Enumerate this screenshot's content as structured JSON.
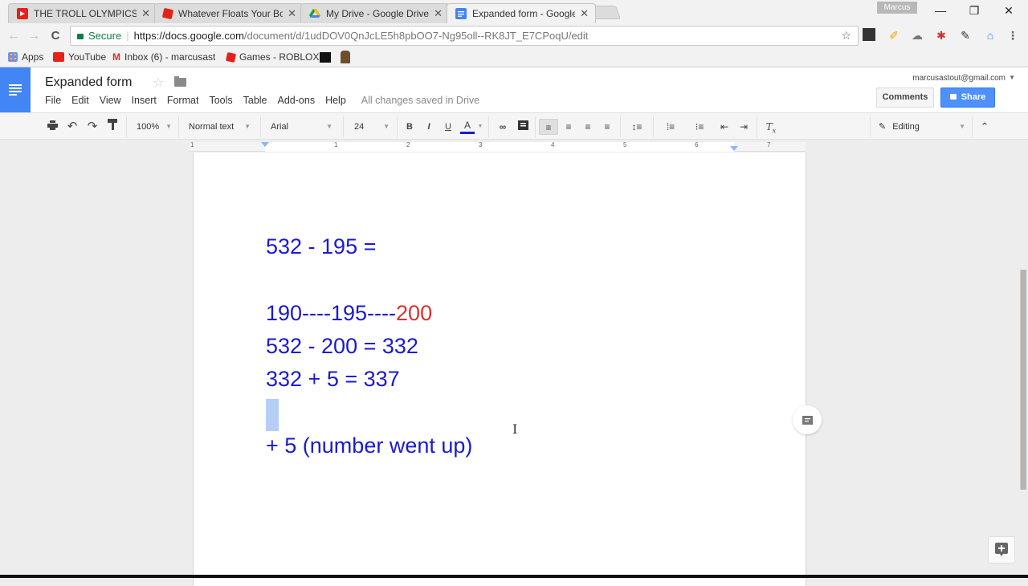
{
  "browser": {
    "tabs": [
      {
        "title": "THE TROLL OLYMPICS!! -",
        "icon": "youtube-icon",
        "color": "#e62117",
        "active": false
      },
      {
        "title": "Whatever Floats Your Bo",
        "icon": "roblox-icon",
        "color": "#e2231a",
        "active": false
      },
      {
        "title": "My Drive - Google Drive",
        "icon": "google-drive-icon",
        "color": "#fbbc04",
        "active": false
      },
      {
        "title": "Expanded form - Google",
        "icon": "google-docs-icon",
        "color": "#4285f4",
        "active": true
      }
    ],
    "close_glyph": "✕",
    "profile_name": "Marcus",
    "window_controls": {
      "minimize": "—",
      "restore": "❐",
      "close": "✕"
    },
    "nav": {
      "back": "←",
      "forward": "→",
      "reload": "C"
    },
    "omnibox": {
      "secure_label": "Secure",
      "url_host": "https://docs.google.com",
      "url_path": "/document/d/1udDOV0QnJcLE5h8pbOO7-Ng95oll--RK8JT_E7CPoqU/edit"
    },
    "bookmarks": [
      {
        "label": "Apps",
        "icon": "apps-grid-icon"
      },
      {
        "label": "YouTube",
        "icon": "youtube-icon"
      },
      {
        "label": "Inbox (6) - marcusast",
        "icon": "gmail-icon"
      },
      {
        "label": "Games - ROBLOX",
        "icon": "roblox-icon"
      }
    ]
  },
  "docs": {
    "title": "Expanded form",
    "menu": [
      "File",
      "Edit",
      "View",
      "Insert",
      "Format",
      "Tools",
      "Table",
      "Add-ons",
      "Help"
    ],
    "save_status": "All changes saved in Drive",
    "account_email": "marcusastout@gmail.com",
    "comments_label": "Comments",
    "share_label": "Share",
    "toolbar": {
      "zoom": "100%",
      "style": "Normal text",
      "font": "Arial",
      "size": "24",
      "bold": "B",
      "italic": "I",
      "underline": "U",
      "text_color": "A",
      "mode": "Editing"
    },
    "ruler_numbers": [
      "1",
      "1",
      "2",
      "3",
      "4",
      "5",
      "6",
      "7"
    ],
    "content": {
      "line1": "532 - 195 =",
      "line2_part1": "190----195----",
      "line2_part2": "200",
      "line3": "532 - 200 = 332",
      "line4": "332 + 5 = 337",
      "line5": "+ 5 (number went up)"
    },
    "colors": {
      "text_blue": "#1a1ad3",
      "text_red": "#e03030",
      "accent": "#4285f4"
    }
  }
}
